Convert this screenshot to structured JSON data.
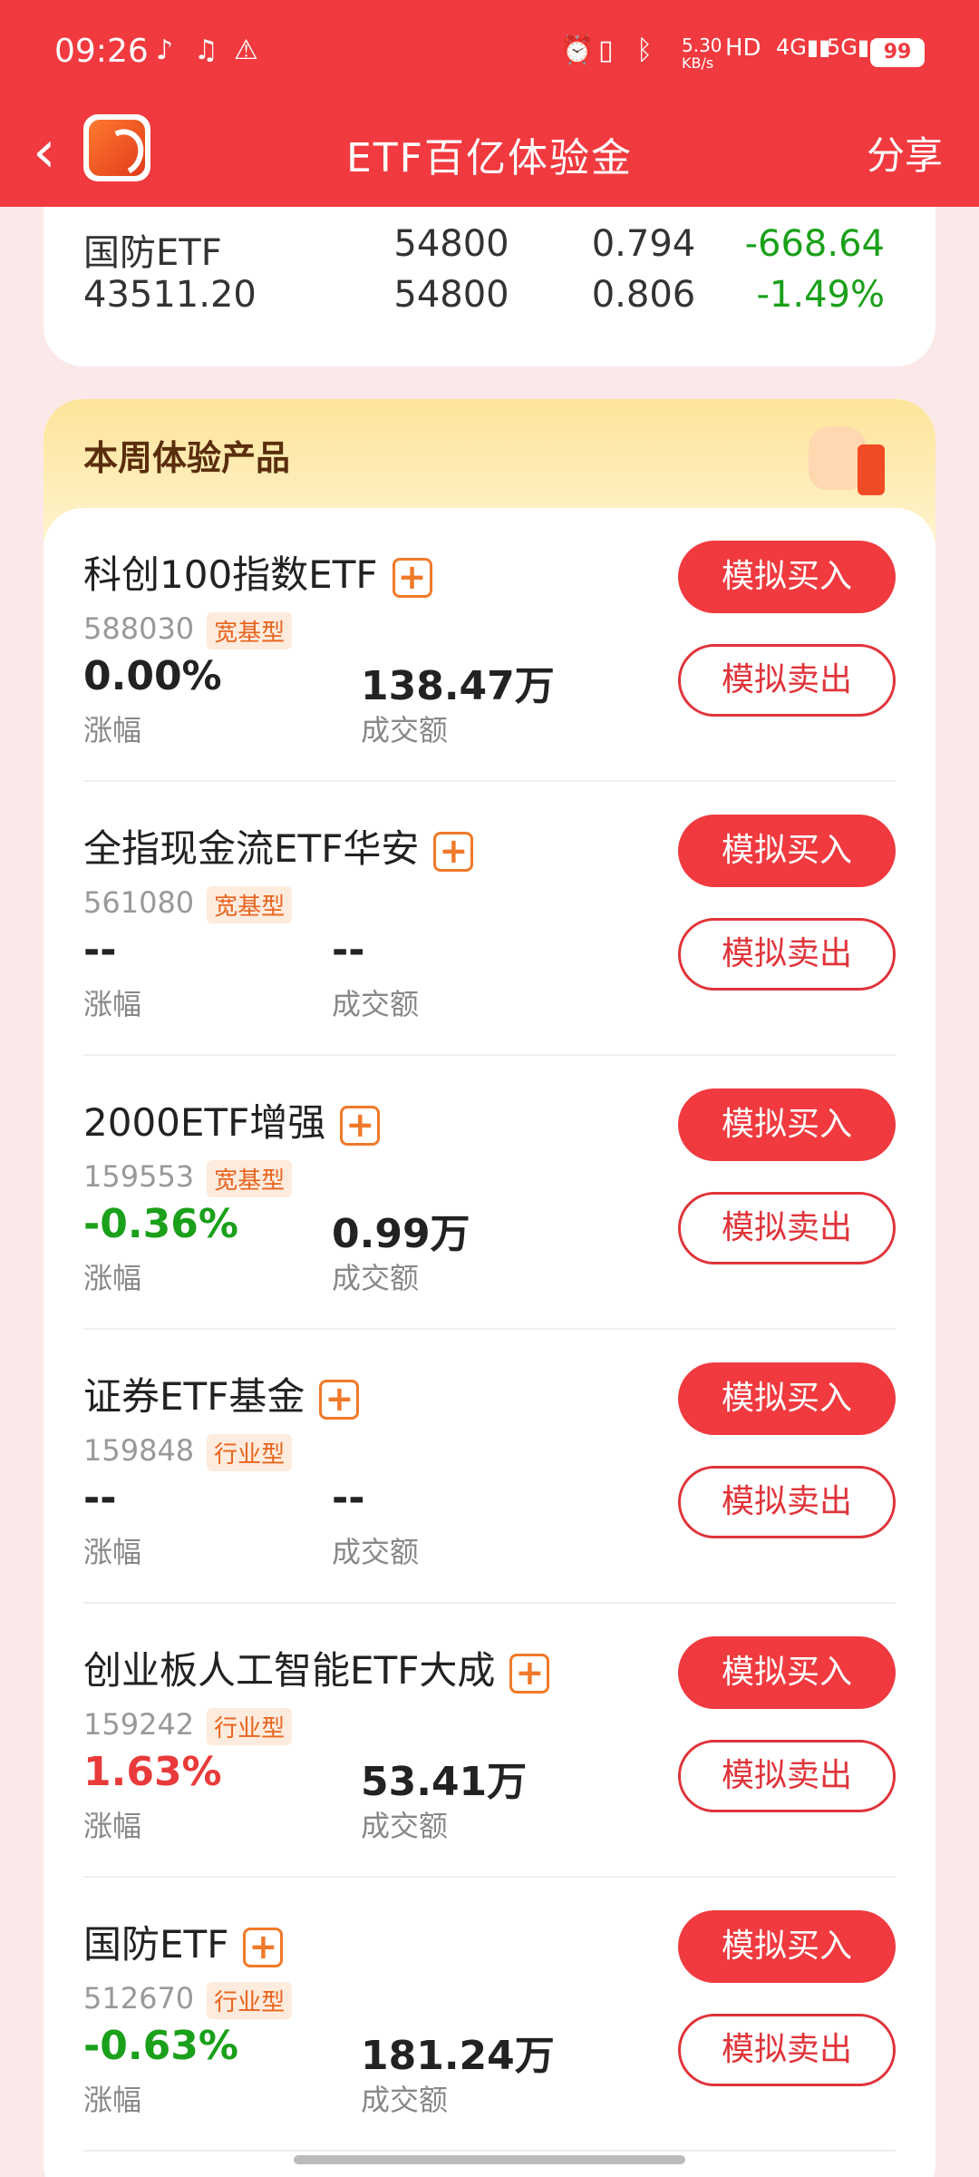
{
  "status_bar": {
    "time": "09:26",
    "net_speed": "5.30",
    "net_unit": "KB/s",
    "battery": "99"
  },
  "header": {
    "title": "ETF百亿体验金",
    "share": "分享"
  },
  "summary": {
    "name": "国防ETF",
    "value_a": "43511.20",
    "col2_top": "54800",
    "col2_bottom": "54800",
    "col3_top": "0.794",
    "col3_bottom": "0.806",
    "col4_top": "-668.64",
    "col4_bottom": "-1.49%"
  },
  "section": {
    "title": "本周体验产品",
    "change_label": "涨幅",
    "volume_label": "成交额",
    "buy_label": "模拟买入",
    "sell_label": "模拟卖出"
  },
  "products": [
    {
      "name": "科创100指数ETF",
      "code": "588030",
      "tag": "宽基型",
      "change": "0.00%",
      "change_color": "#222222",
      "volume": "138.47万"
    },
    {
      "name": "全指现金流ETF华安",
      "code": "561080",
      "tag": "宽基型",
      "change": "--",
      "change_color": "#222222",
      "volume": "--"
    },
    {
      "name": "2000ETF增强",
      "code": "159553",
      "tag": "宽基型",
      "change": "-0.36%",
      "change_color": "#1aa01a",
      "volume": "0.99万"
    },
    {
      "name": "证券ETF基金",
      "code": "159848",
      "tag": "行业型",
      "change": "--",
      "change_color": "#222222",
      "volume": "--"
    },
    {
      "name": "创业板人工智能ETF大成",
      "code": "159242",
      "tag": "行业型",
      "change": "1.63%",
      "change_color": "#e83a3a",
      "volume": "53.41万"
    },
    {
      "name": "国防ETF",
      "code": "512670",
      "tag": "行业型",
      "change": "-0.63%",
      "change_color": "#1aa01a",
      "volume": "181.24万"
    }
  ]
}
